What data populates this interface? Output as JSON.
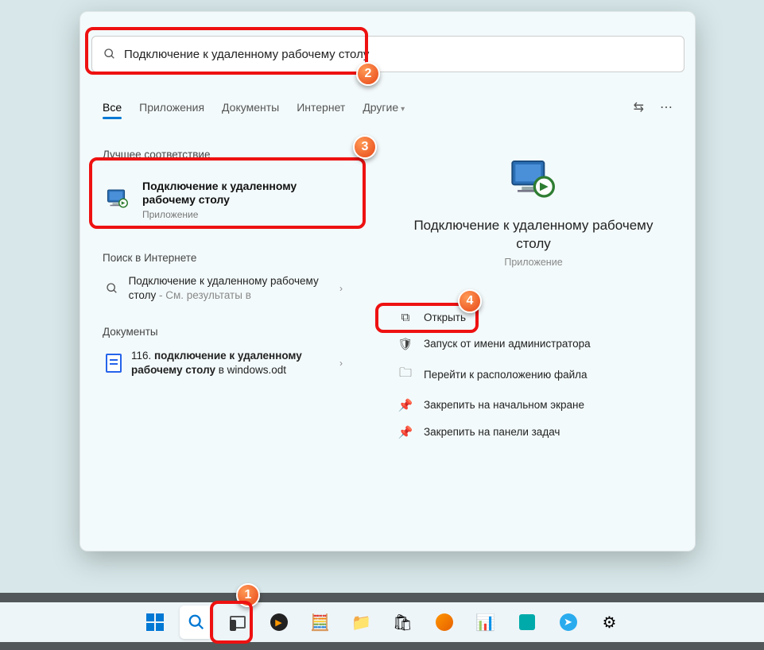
{
  "search": {
    "value": "Подключение к удаленному рабочему столу"
  },
  "tabs": {
    "all": "Все",
    "apps": "Приложения",
    "docs": "Документы",
    "web": "Интернет",
    "more": "Другие"
  },
  "sections": {
    "best": "Лучшее соответствие",
    "web": "Поиск в Интернете",
    "docs": "Документы"
  },
  "best": {
    "title": "Подключение к удаленному рабочему столу",
    "subtitle": "Приложение"
  },
  "webResult": {
    "prefix": "Подключение к удаленному рабочему столу",
    "suffix": " - См. результаты в"
  },
  "docResult": {
    "prefix": "116. ",
    "bold": "подключение к удаленному рабочему столу",
    "suffix": " в windows.odt"
  },
  "detail": {
    "title": "Подключение к удаленному рабочему столу",
    "subtitle": "Приложение"
  },
  "actions": {
    "open": "Открыть",
    "admin": "Запуск от имени администратора",
    "location": "Перейти к расположению файла",
    "pinStart": "Закрепить на начальном экране",
    "pinTaskbar": "Закрепить на панели задач"
  },
  "annotations": {
    "n1": "1",
    "n2": "2",
    "n3": "3",
    "n4": "4"
  }
}
